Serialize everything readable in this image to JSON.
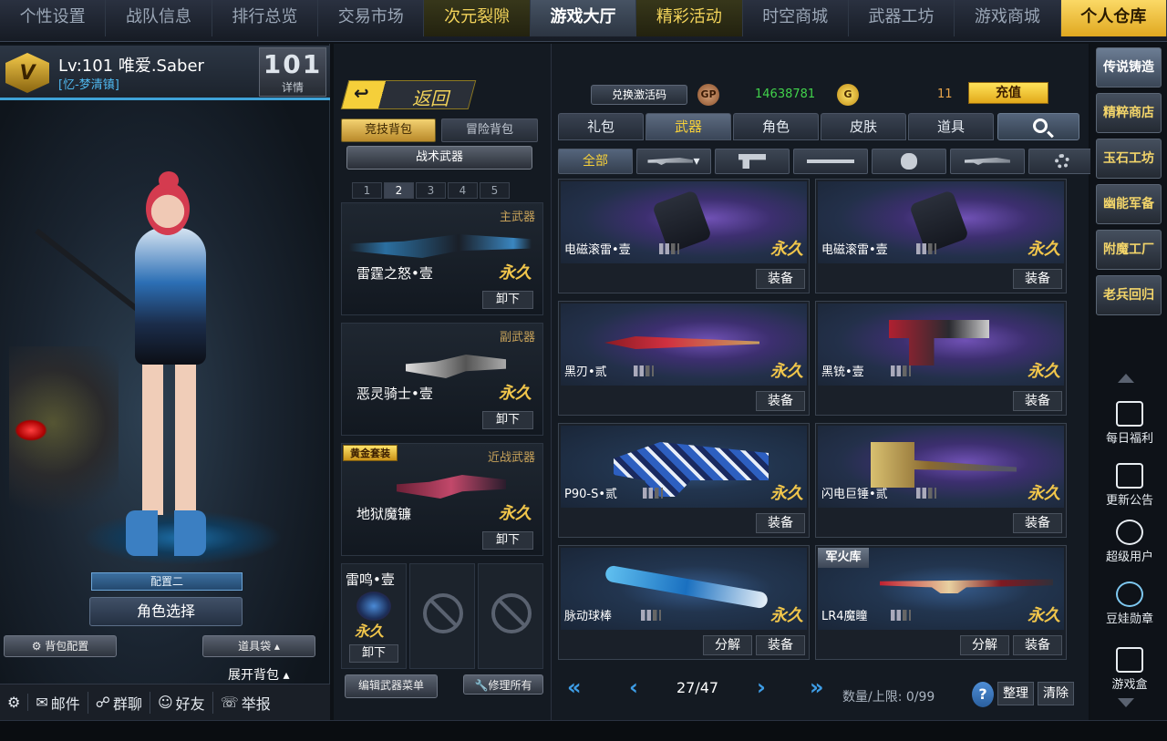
{
  "topnav": [
    "个性设置",
    "战队信息",
    "排行总览",
    "交易市场",
    "次元裂隙",
    "游戏大厅",
    "精彩活动",
    "时空商城",
    "武器工坊",
    "游戏商城",
    "个人仓库"
  ],
  "player": {
    "vip_badge": "V",
    "name": "Lv:101 唯爱.Saber",
    "clan": "[忆-梦清镇]",
    "rank_number": "101",
    "rank_detail": "详情"
  },
  "left": {
    "config_label": "配置二",
    "character_select": "角色选择",
    "bag_config": "背包配置",
    "item_bag": "道具袋",
    "expand_bag": "展开背包",
    "bottom": [
      "邮件",
      "群聊",
      "好友",
      "举报"
    ]
  },
  "mid": {
    "back": "返回",
    "bag_tabs": [
      "竞技背包",
      "冒险背包"
    ],
    "tactical": "战术武器",
    "pages": [
      "1",
      "2",
      "3",
      "4",
      "5"
    ],
    "active_page": "2",
    "slots": [
      {
        "type": "主武器",
        "name": "雷霆之怒•壹",
        "perm": "永久",
        "unload": "卸下"
      },
      {
        "type": "副武器",
        "name": "恶灵骑士•壹",
        "perm": "永久",
        "unload": "卸下"
      },
      {
        "type": "近战武器",
        "name": "地狱魔镰",
        "perm": "永久",
        "unload": "卸下",
        "badge": "黄金套装"
      }
    ],
    "grenade": {
      "name": "雷鸣•壹",
      "perm": "永久",
      "unload": "卸下"
    },
    "edit_weapons": "编辑武器菜单",
    "repair_all": "修理所有"
  },
  "right": {
    "redeem": "兑换激活码",
    "gp_icon": "GP",
    "gp_value": "14638781",
    "gold_icon": "G",
    "gold_value": "11",
    "recharge": "充值",
    "tabs": [
      "礼包",
      "武器",
      "角色",
      "皮肤",
      "道具"
    ],
    "active_tab": "武器",
    "subtab_all": "全部",
    "cards": [
      {
        "name": "电磁滚雷•壹",
        "perm": "永久",
        "equip": "装备"
      },
      {
        "name": "电磁滚雷•壹",
        "perm": "永久",
        "equip": "装备"
      },
      {
        "name": "黑刃•贰",
        "perm": "永久",
        "equip": "装备"
      },
      {
        "name": "黑铳•壹",
        "perm": "永久",
        "equip": "装备"
      },
      {
        "name": "P90-S•贰",
        "perm": "永久",
        "equip": "装备"
      },
      {
        "name": "闪电巨锤•贰",
        "perm": "永久",
        "equip": "装备"
      },
      {
        "name": "脉动球棒",
        "perm": "永久",
        "equip": "装备",
        "decompose": "分解"
      },
      {
        "name": "LR4魔瞳",
        "perm": "永久",
        "equip": "装备",
        "decompose": "分解",
        "badge": "军火库"
      }
    ],
    "page_current": "27/47",
    "capacity": "数量/上限: 0/99",
    "help": "?",
    "sort": "整理",
    "clear": "清除"
  },
  "farright": {
    "buttons": [
      "传说铸造",
      "精粹商店",
      "玉石工坊",
      "幽能军备",
      "附魔工厂",
      "老兵回归"
    ],
    "items": [
      "每日福利",
      "更新公告",
      "超级用户",
      "豆娃勋章",
      "游戏盒"
    ]
  },
  "colors": {
    "accent_gold": "#f1c64b",
    "accent_blue": "#3e9de6",
    "gp_green": "#41d24b"
  }
}
